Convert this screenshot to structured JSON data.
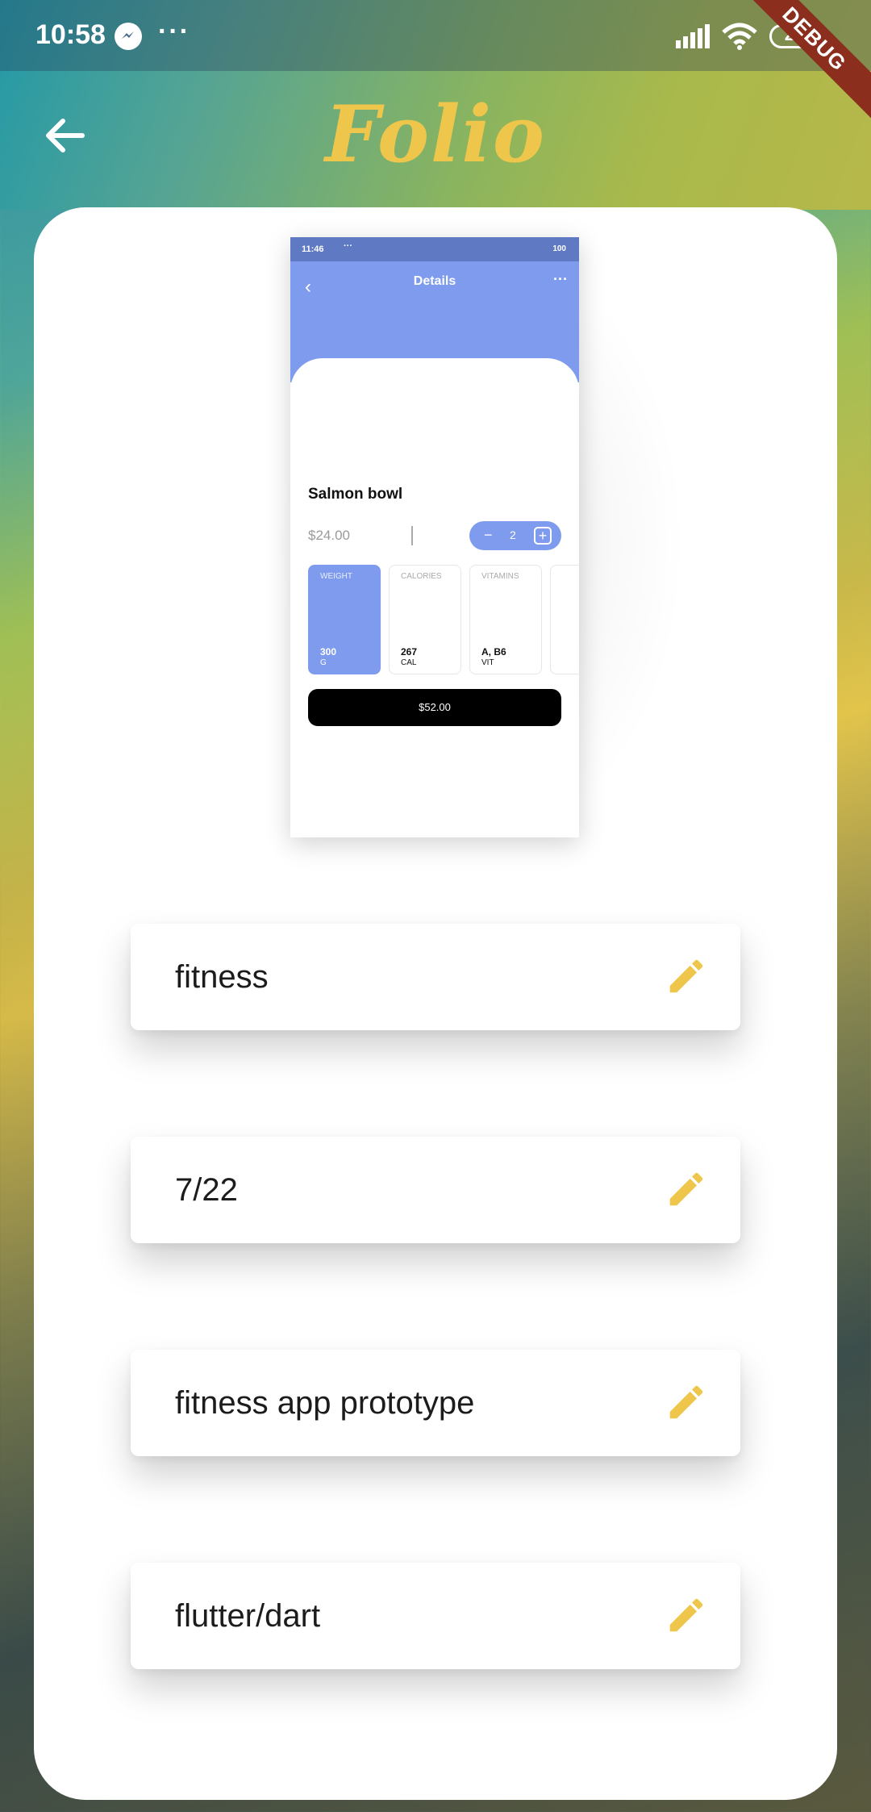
{
  "status_bar": {
    "time": "10:58",
    "more": "···",
    "battery": "26",
    "debug_label": "DEBUG"
  },
  "app_bar": {
    "title": "Folio",
    "back_icon": "arrow-left-icon",
    "title_color": "#efc64c"
  },
  "preview": {
    "status_time": "11:46",
    "status_dots": "···",
    "status_battery": "100",
    "title": "Details",
    "more": "···",
    "item_name": "Salmon bowl",
    "price": "$24.00",
    "quantity": "2",
    "minus": "−",
    "plus": "+",
    "accent_color": "#7f9bee",
    "nutrition": [
      {
        "label": "WEIGHT",
        "value": "300",
        "unit": "G"
      },
      {
        "label": "CALORIES",
        "value": "267",
        "unit": "CAL"
      },
      {
        "label": "VITAMINS",
        "value": "A, B6",
        "unit": "VIT"
      }
    ],
    "total_button": "$52.00"
  },
  "fields": [
    {
      "value": "fitness",
      "icon": "pencil-icon"
    },
    {
      "value": "7/22",
      "icon": "pencil-icon"
    },
    {
      "value": "fitness app prototype",
      "icon": "pencil-icon"
    },
    {
      "value": "flutter/dart",
      "icon": "pencil-icon"
    }
  ]
}
